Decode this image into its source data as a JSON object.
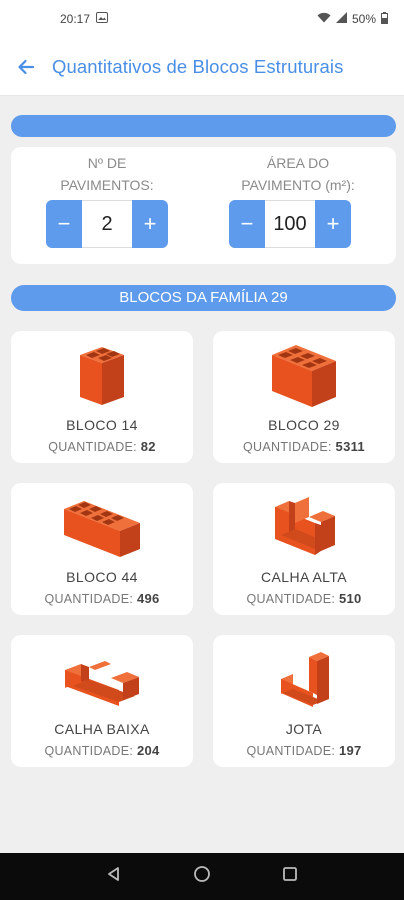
{
  "status_bar": {
    "time": "20:17",
    "battery": "50%"
  },
  "app_bar": {
    "title": "Quantitativos de Blocos Estruturais"
  },
  "top_banner": {
    "text": ""
  },
  "inputs": {
    "floors": {
      "label_line1": "Nº DE",
      "label_line2": "PAVIMENTOS:",
      "value": "2",
      "minus": "−",
      "plus": "+"
    },
    "area": {
      "label_line1": "ÁREA DO",
      "label_line2": "PAVIMENTO (m²):",
      "value": "100",
      "minus": "−",
      "plus": "+"
    }
  },
  "family_banner": {
    "text": "BLOCOS DA FAMÍLIA 29"
  },
  "qty_label": "QUANTIDADE:",
  "blocks": [
    {
      "name": "BLOCO 14",
      "qty": "82",
      "icon": "block-14-icon"
    },
    {
      "name": "BLOCO 29",
      "qty": "5311",
      "icon": "block-29-icon"
    },
    {
      "name": "BLOCO 44",
      "qty": "496",
      "icon": "block-44-icon"
    },
    {
      "name": "CALHA ALTA",
      "qty": "510",
      "icon": "calha-alta-icon"
    },
    {
      "name": "CALHA BAIXA",
      "qty": "204",
      "icon": "calha-baixa-icon"
    },
    {
      "name": "JOTA",
      "qty": "197",
      "icon": "jota-icon"
    }
  ],
  "colors": {
    "accent": "#5e9bec",
    "title": "#4a8fe6",
    "brick": "#e8521f",
    "brick_dark": "#c2411a",
    "brick_light": "#f0703b"
  }
}
